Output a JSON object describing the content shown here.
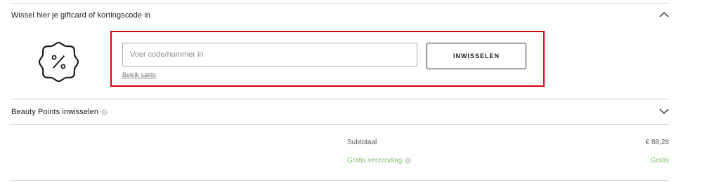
{
  "giftcard_section": {
    "title": "Wissel hier je giftcard of kortingscode in",
    "input_placeholder": "Voer code/nummer in",
    "input_value": "",
    "redeem_button": "INWISSELEN",
    "balance_link": "Bekijk saldo",
    "expanded": true
  },
  "beauty_section": {
    "title": "Beauty Points inwisselen",
    "info": "i",
    "expanded": false
  },
  "summary": {
    "subtotal_label": "Subtotaal",
    "subtotal_value": "€ 88,28",
    "shipping_label": "Gratis verzending",
    "shipping_info": "i",
    "shipping_value": "Gratis"
  },
  "colors": {
    "highlight": "#e3000f",
    "free_shipping": "#7cc26b"
  },
  "icons": {
    "discount_badge": "percent-badge-icon",
    "collapse": "chevron-up-icon",
    "expand": "chevron-down-icon",
    "info": "info-icon"
  }
}
